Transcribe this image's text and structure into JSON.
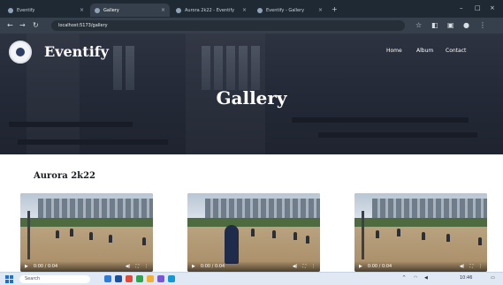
{
  "browser": {
    "tabs": [
      {
        "label": "Eventify"
      },
      {
        "label": "Gallery"
      },
      {
        "label": "Aurora 2k22 - Eventify"
      },
      {
        "label": "Eventify - Gallery"
      }
    ],
    "url": "localhost:5173/gallery"
  },
  "header": {
    "brand": "Eventify",
    "nav": [
      "Home",
      "Album",
      "Contact"
    ],
    "hero_title": "Gallery"
  },
  "gallery": {
    "section_title": "Aurora 2k22",
    "videos": [
      {
        "time": "0:00 / 0:04"
      },
      {
        "time": "0:00 / 0:04"
      },
      {
        "time": "0:00 / 0:04"
      }
    ]
  },
  "taskbar": {
    "search_placeholder": "Search",
    "clock": "10:46"
  },
  "colors": {
    "titlebar": "#1f2933",
    "toolbar": "#35404c",
    "hero_overlay": "#2e3544",
    "text_dark": "#1b1e24",
    "taskbar": "#dfe8f3"
  }
}
